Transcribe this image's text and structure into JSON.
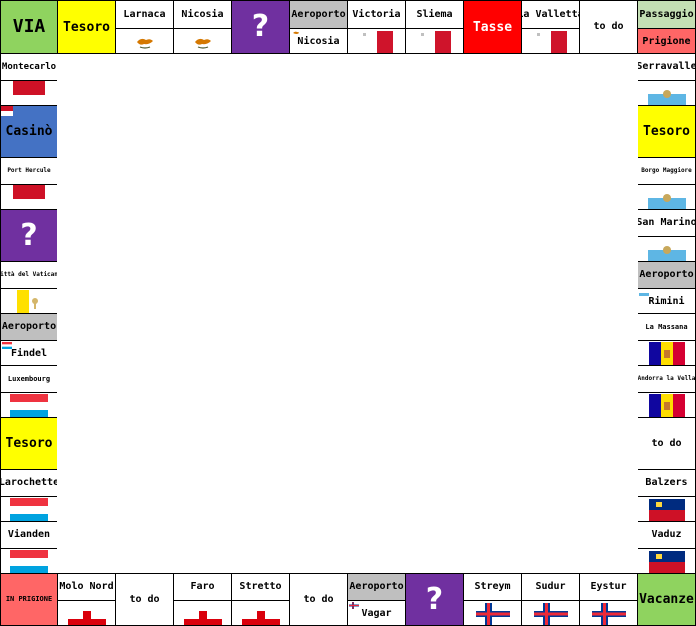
{
  "top": {
    "via": {
      "label": "VIA",
      "color": "#8fd35f"
    },
    "tesoro": {
      "label": "Tesoro",
      "color": "#ffff00"
    },
    "larnaca": {
      "label": "Larnaca",
      "flag": "cyprus"
    },
    "nicosia": {
      "label": "Nicosia",
      "flag": "cyprus"
    },
    "chance": {
      "label": "?",
      "color": "#7030a0"
    },
    "aeroporto": {
      "label": "Aeroporto",
      "sub": "Nicosia",
      "color": "#bfbfbf",
      "flag": "cyprus-mini"
    },
    "victoria": {
      "label": "Victoria",
      "flag": "malta"
    },
    "sliema": {
      "label": "Sliema",
      "flag": "malta"
    },
    "tasse": {
      "label": "Tasse",
      "color": "#ff0000"
    },
    "lavalletta": {
      "label": "La Valletta",
      "flag": "malta"
    },
    "todo": {
      "label": "to do"
    },
    "passaggio": {
      "label": "Passaggio",
      "sub": "Prigione",
      "color_top": "#c4dfb4",
      "color_bottom": "#ff6666"
    }
  },
  "left": {
    "montecarlo": {
      "label": "Montecarlo",
      "flag": "monaco"
    },
    "casino": {
      "label": "Casinò",
      "color": "#4472c4",
      "flag": "monaco-mini"
    },
    "portercole": {
      "label": "Port Hercule",
      "flag": "monaco"
    },
    "chance": {
      "label": "?",
      "color": "#7030a0"
    },
    "cittavaticano": {
      "label": "Città del Vaticano",
      "flag": "vatican"
    },
    "aeroporto": {
      "label": "Aeroporto",
      "sub": "Findel",
      "color": "#bfbfbf",
      "flag": "luxembourg-mini"
    },
    "luxembourg": {
      "label": "Luxembourg",
      "flag": "luxembourg"
    },
    "tesoro": {
      "label": "Tesoro",
      "color": "#ffff00"
    },
    "larochette": {
      "label": "Larochette",
      "flag": "luxembourg"
    },
    "vianden": {
      "label": "Vianden",
      "flag": "luxembourg"
    }
  },
  "right": {
    "serravalle": {
      "label": "Serravalle",
      "flag": "sanmarino"
    },
    "tesoro": {
      "label": "Tesoro",
      "color": "#ffff00"
    },
    "borgomaggiore": {
      "label": "Borgo Maggiore",
      "flag": "sanmarino"
    },
    "sanmarino": {
      "label": "San Marino",
      "flag": "sanmarino"
    },
    "aeroporto": {
      "label": "Aeroporto",
      "sub": "Rimini",
      "color": "#bfbfbf",
      "flag": "sanmarino-mini"
    },
    "lamassana": {
      "label": "La Massana",
      "flag": "andorra"
    },
    "andorra": {
      "label": "Andorra la Vella",
      "flag": "andorra"
    },
    "todo": {
      "label": "to do"
    },
    "balzers": {
      "label": "Balzers",
      "flag": "liechtenstein"
    },
    "vaduz": {
      "label": "Vaduz",
      "flag": "liechtenstein"
    }
  },
  "bottom": {
    "prigione": {
      "label": "IN PRIGIONE",
      "color": "#ff6666"
    },
    "molonord": {
      "label": "Molo Nord",
      "flag": "gibraltar"
    },
    "todo1": {
      "label": "to do"
    },
    "faro": {
      "label": "Faro",
      "flag": "gibraltar"
    },
    "stretto": {
      "label": "Stretto",
      "flag": "gibraltar"
    },
    "todo2": {
      "label": "to do"
    },
    "aeroporto": {
      "label": "Aeroporto",
      "sub": "Vagar",
      "color": "#bfbfbf",
      "flag": "faroe-mini"
    },
    "chance": {
      "label": "?",
      "color": "#7030a0"
    },
    "streymoy": {
      "label": "Streym",
      "flag": "faroe"
    },
    "sudur": {
      "label": "Sudur",
      "flag": "faroe"
    },
    "eystur": {
      "label": "Eystur",
      "flag": "faroe"
    },
    "vacanze": {
      "label": "Vacanze",
      "color": "#8fd35f"
    }
  }
}
